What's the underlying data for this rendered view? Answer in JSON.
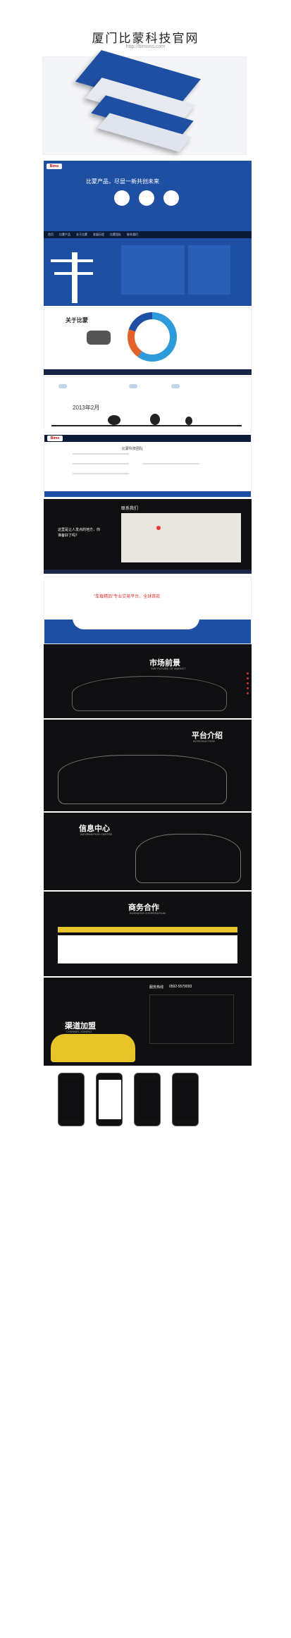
{
  "header": {
    "title": "厦门比蒙科技官网",
    "subtitle": "http://bimons.com"
  },
  "brand": {
    "logo": "Bimo",
    "primary": "#1e4fa3",
    "dark": "#0f0f12",
    "accent": "#e2622a"
  },
  "nav": {
    "items": [
      "首页",
      "比蒙产品",
      "关于比蒙",
      "发展历程",
      "比蒙团队",
      "联系我们"
    ]
  },
  "hero": {
    "slogan": "比蒙产品，尽显一新共创未来"
  },
  "about": {
    "heading": "关于比蒙"
  },
  "timeline": {
    "date": "2013年2月"
  },
  "team": {
    "heading": "比蒙科技团队"
  },
  "contact": {
    "heading": "联系我们",
    "slogan": "这里是让人发点的地方，你准备好了吗？"
  },
  "platform": {
    "slogan": "\"车载精品\"专业交易平台，全球首款"
  },
  "sections": [
    {
      "title": "市场前景",
      "subtitle": "THE FUTURE OF MARKET"
    },
    {
      "title": "平台介绍",
      "subtitle": "INTRODUCTION"
    },
    {
      "title": "信息中心",
      "subtitle": "INFORMATION CENTRE"
    },
    {
      "title": "商务合作",
      "subtitle": "BUSINESS COOPERATION"
    },
    {
      "title": "渠道加盟",
      "subtitle": "CHANNEL JOINING"
    }
  ],
  "hotline": {
    "label": "服务热线",
    "number": "0592-5579093"
  }
}
